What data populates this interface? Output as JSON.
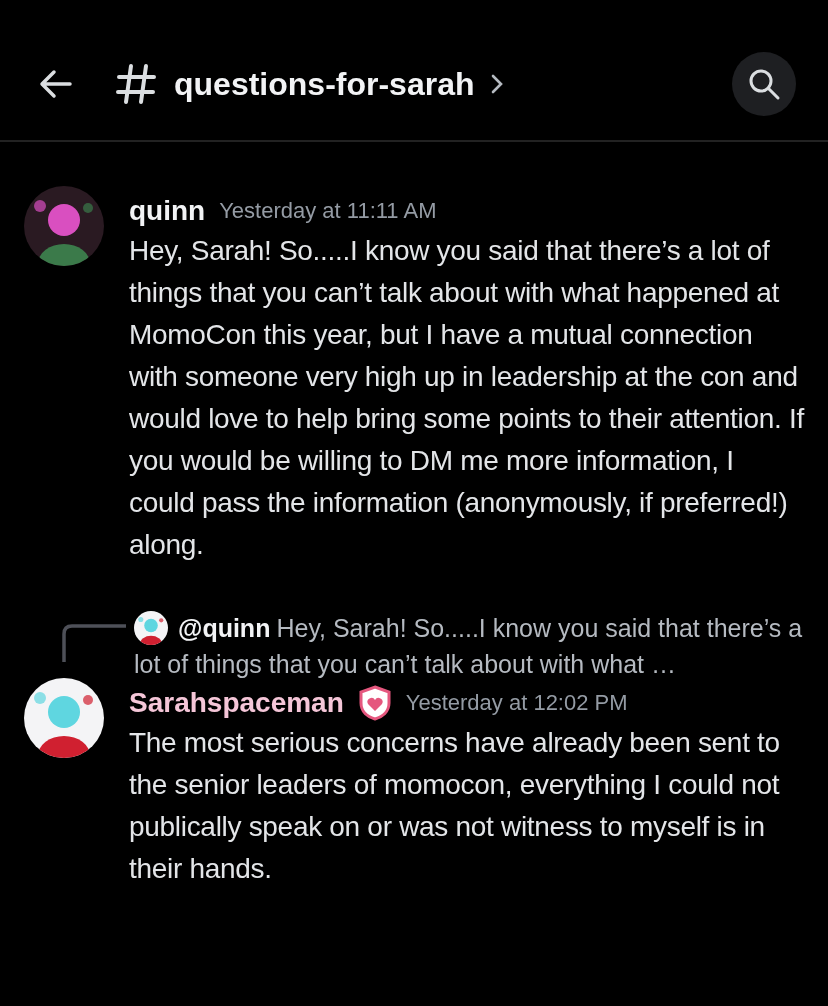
{
  "header": {
    "channel": "questions-for-sarah"
  },
  "messages": [
    {
      "author": "quinn",
      "color": "#f2f3f5",
      "badge": false,
      "time": "Yesterday at 11:11 AM",
      "text": "Hey, Sarah! So.....I know you said that there’s a lot of things that you can’t talk about with what happened at MomoCon this year, but I have a mutual connection with someone very high up in leadership at the con and would love to help bring some points to their attention. If you would be willing to DM me more information, I could pass the information (anonymously, if preferred!) along."
    },
    {
      "reply_to": {
        "author": "@quinn",
        "text": "Hey, Sarah! So.....I know you said that there’s a lot of things that you can’t talk about with what …"
      },
      "author": "Sarahspaceman",
      "color": "#f5c6d8",
      "badge": true,
      "time": "Yesterday at 12:02 PM",
      "text": "The most serious concerns have already been sent to the senior leaders of momocon, everything I could not publically speak on or was not witness to myself is in their hands."
    }
  ]
}
